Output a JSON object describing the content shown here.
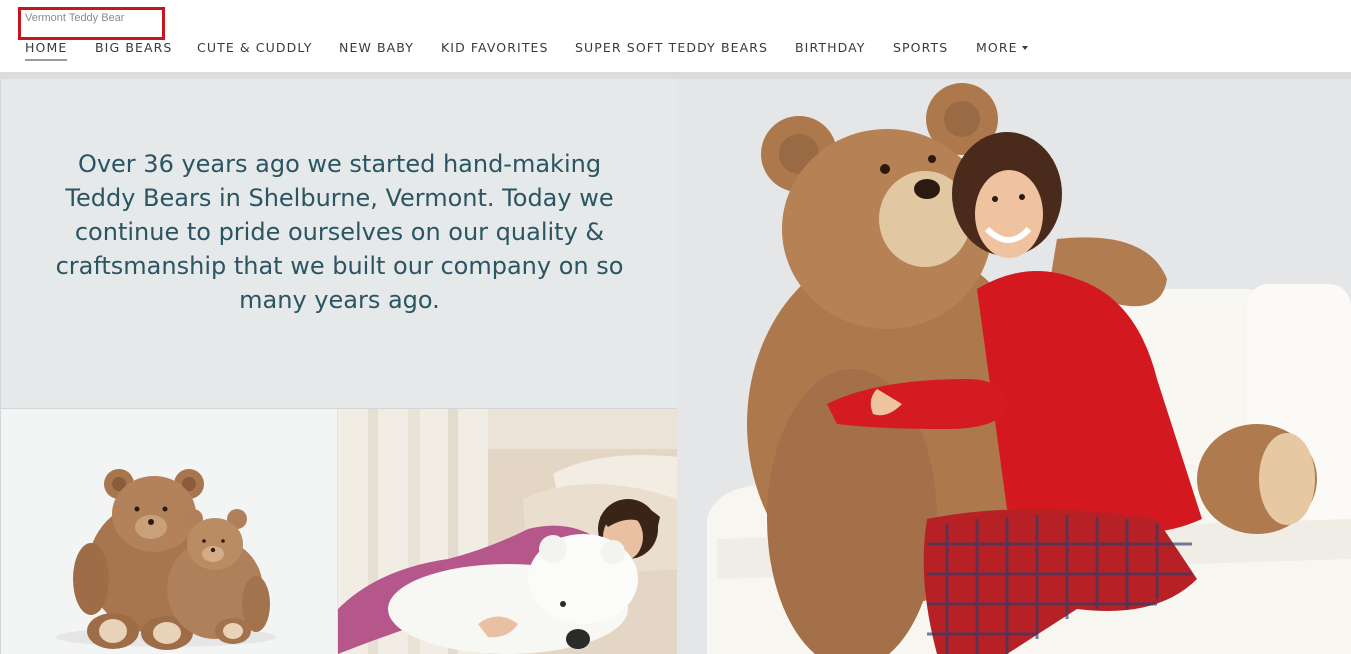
{
  "header": {
    "brand": "Vermont Teddy Bear",
    "nav": [
      {
        "label": "HOME"
      },
      {
        "label": "BIG BEARS"
      },
      {
        "label": "CUTE & CUDDLY"
      },
      {
        "label": "NEW BABY"
      },
      {
        "label": "KID FAVORITES"
      },
      {
        "label": "SUPER SOFT TEDDY BEARS"
      },
      {
        "label": "BIRTHDAY"
      },
      {
        "label": "SPORTS"
      },
      {
        "label": "MORE"
      }
    ]
  },
  "intro": {
    "text": "Over 36 years ago we started hand-making Teddy Bears in Shelburne, Vermont. Today we continue to pride ourselves on our quality & craftsmanship that we built our company on so many years ago."
  },
  "colors": {
    "brand_box_border": "#c8141a",
    "intro_text": "#2b5563",
    "intro_bg": "#e6e9ea"
  },
  "icons": {
    "more_dropdown": "chevron-down-icon"
  }
}
